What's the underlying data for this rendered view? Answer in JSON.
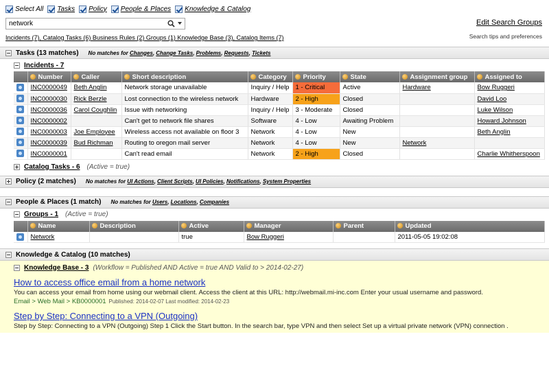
{
  "filters": {
    "select_all": "Select All",
    "items": [
      "Tasks",
      "Policy",
      "People & Places",
      "Knowledge & Catalog"
    ]
  },
  "search": {
    "value": "network",
    "placeholder": ""
  },
  "counts": "Incidents (7), Catalog Tasks (6) Business Rules (2) Groups (1) Knowledge Base (3), Catalog Items (7)",
  "edit_search_groups": "Edit Search Groups",
  "search_tips": "Search tips and preferences",
  "tasks": {
    "title": "Tasks",
    "matches": "(13 matches)",
    "no_matches_prefix": "No matches for",
    "no_matches": [
      "Changes",
      "Change Tasks",
      "Problems",
      "Requests",
      "Tickets"
    ],
    "incidents": {
      "title": "Incidents - 7",
      "columns": [
        "Number",
        "Caller",
        "Short description",
        "Category",
        "Priority",
        "State",
        "Assignment group",
        "Assigned to"
      ],
      "rows": [
        [
          "INC0000049",
          "Beth Anglin",
          "Network storage unavailable",
          "Inquiry / Help",
          "1 - Critical",
          "Active",
          "Hardware",
          "Bow Ruggeri"
        ],
        [
          "INC0000030",
          "Rick Berzle",
          "Lost connection to the wireless network",
          "Hardware",
          "2 - High",
          "Closed",
          "",
          "David Loo"
        ],
        [
          "INC0000036",
          "Carol Coughlin",
          "Issue with networking",
          "Inquiry / Help",
          "3 - Moderate",
          "Closed",
          "",
          "Luke Wilson"
        ],
        [
          "INC0000002",
          "",
          "Can't get to network file shares",
          "Software",
          "4 - Low",
          "Awaiting Problem",
          "",
          "Howard Johnson"
        ],
        [
          "INC0000003",
          "Joe Employee",
          "Wireless access not available on floor 3",
          "Network",
          "4 - Low",
          "New",
          "",
          "Beth Anglin"
        ],
        [
          "INC0000039",
          "Bud Richman",
          "Routing to oregon mail server",
          "Network",
          "4 - Low",
          "New",
          "Network",
          ""
        ],
        [
          "INC0000001",
          "",
          "Can't read email",
          "Network",
          "2 - High",
          "Closed",
          "",
          "Charlie Whitherspoon"
        ]
      ],
      "priority_colors": {
        "1 - Critical": "#f56c3a",
        "2 - High": "#f7a21a"
      }
    },
    "catalog_tasks": {
      "title": "Catalog Tasks - 6",
      "condition": "(Active = true)"
    }
  },
  "policy": {
    "title": "Policy",
    "matches": "(2 matches)",
    "no_matches_prefix": "No matches for",
    "no_matches": [
      "UI Actions",
      "Client Scripts",
      "UI Policies",
      "Notifications",
      "System Properties"
    ]
  },
  "people": {
    "title": "People & Places",
    "matches": "(1 match)",
    "no_matches_prefix": "No matches for",
    "no_matches": [
      "Users",
      "Locations",
      "Companies"
    ],
    "groups": {
      "title": "Groups - 1",
      "condition": "(Active = true)",
      "columns": [
        "Name",
        "Description",
        "Active",
        "Manager",
        "Parent",
        "Updated"
      ],
      "rows": [
        [
          "Network",
          "",
          "true",
          "Bow Ruggeri",
          "",
          "2011-05-05 19:02:08"
        ]
      ]
    }
  },
  "knowledge": {
    "title": "Knowledge & Catalog",
    "matches": "(10 matches)",
    "kb": {
      "title": "Knowledge Base - 3",
      "condition": "(Workflow = Published AND Active = true AND Valid to > 2014-02-27)",
      "articles": [
        {
          "title": "How to access office email from a home network",
          "body": "You can access your email from home using our webmail client. Access the client at this URL: http://webmail.mi-inc.com Enter your usual username and password.",
          "crumb": "Email > Web Mail > KB0000001",
          "meta": "Published: 2014-02-07   Last modified: 2014-02-23"
        },
        {
          "title": "Step by Step: Connecting to a VPN (Outgoing)",
          "body": "Step by Step: Connecting to a VPN (Outgoing) Step 1  Click the  Start  button. In the search bar, type  VPN  and then select  Set up a virtual private network (VPN) connection ."
        }
      ]
    }
  }
}
